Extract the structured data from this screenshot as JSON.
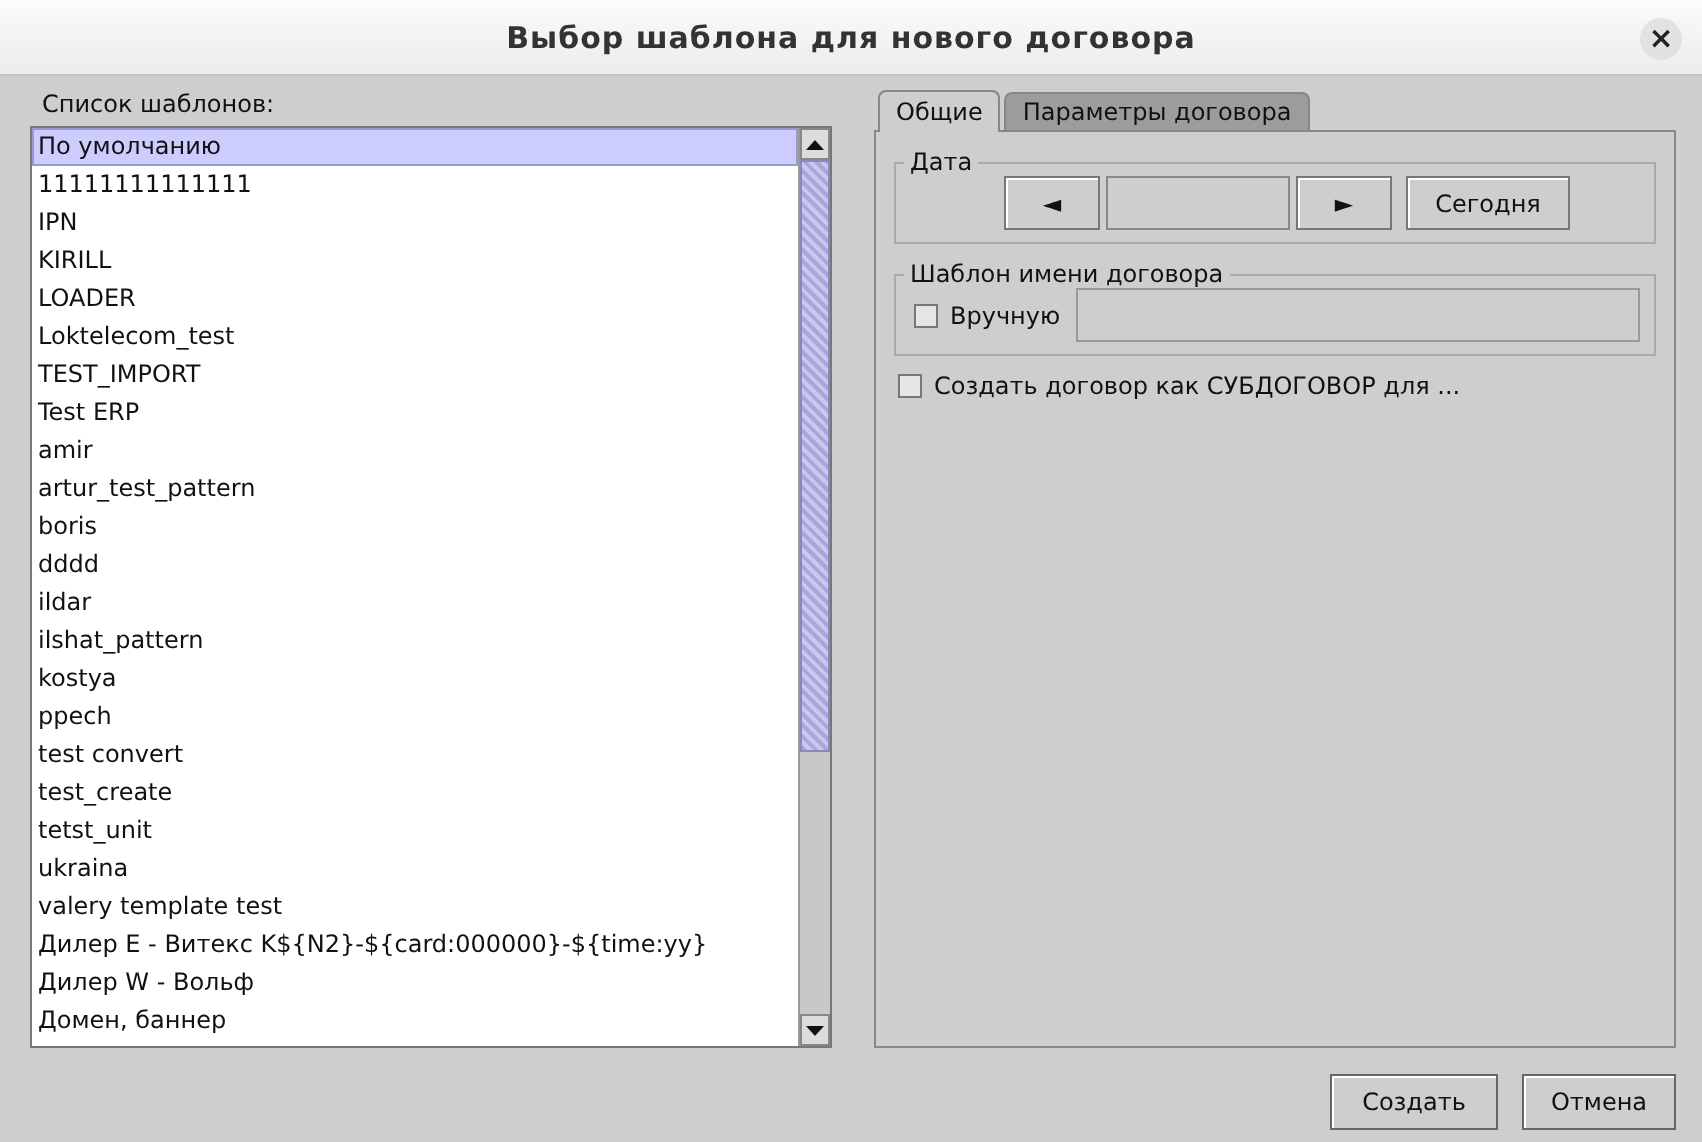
{
  "window": {
    "title": "Выбор шаблона для нового договора",
    "close": "×"
  },
  "templates": {
    "label": "Список шаблонов:",
    "items": [
      {
        "text": "По умолчанию",
        "selected": true
      },
      {
        "text": "11111111111111",
        "selected": false
      },
      {
        "text": "IPN",
        "selected": false
      },
      {
        "text": "KIRILL",
        "selected": false
      },
      {
        "text": "LOADER",
        "selected": false
      },
      {
        "text": "Loktelecom_test",
        "selected": false
      },
      {
        "text": "TEST_IMPORT",
        "selected": false
      },
      {
        "text": "Test ERP",
        "selected": false
      },
      {
        "text": "amir",
        "selected": false
      },
      {
        "text": "artur_test_pattern",
        "selected": false
      },
      {
        "text": "boris",
        "selected": false
      },
      {
        "text": "dddd",
        "selected": false
      },
      {
        "text": "ildar",
        "selected": false
      },
      {
        "text": "ilshat_pattern",
        "selected": false
      },
      {
        "text": "kostya",
        "selected": false
      },
      {
        "text": "ppech",
        "selected": false
      },
      {
        "text": "test convert",
        "selected": false
      },
      {
        "text": "test_create",
        "selected": false
      },
      {
        "text": "tetst_unit",
        "selected": false
      },
      {
        "text": "ukraina",
        "selected": false
      },
      {
        "text": "valery template test",
        "selected": false
      },
      {
        "text": "Дилер  E - Витекс K${N2}-${card:000000}-${time:yy}",
        "selected": false
      },
      {
        "text": "Дилер  W - Вольф",
        "selected": false
      },
      {
        "text": "Домен,  баннер",
        "selected": false
      }
    ]
  },
  "tabs": [
    {
      "label": "Общие",
      "selected": true
    },
    {
      "label": "Параметры договора",
      "selected": false
    }
  ],
  "date_group": {
    "title": "Дата",
    "prev": "◄",
    "next": "►",
    "today": "Сегодня"
  },
  "name_group": {
    "title": "Шаблон имени договора",
    "manual": {
      "label": "Вручную",
      "checked": false
    }
  },
  "subcontract": {
    "label": "Создать договор как СУБДОГОВОР для ...",
    "checked": false
  },
  "buttons": [
    "Создать",
    "Отмена"
  ]
}
